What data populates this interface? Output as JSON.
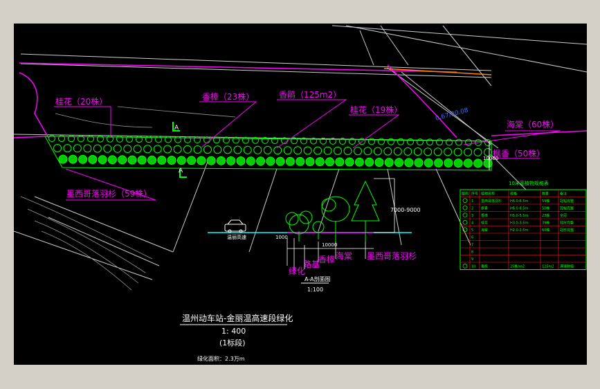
{
  "drawing": {
    "title": "温州动车站-金丽温高速段绿化",
    "scale": "1: 400",
    "section_label": "(1标段)",
    "note": "绿化面积：2.3万m",
    "colors": {
      "background": "#000000",
      "label": "#ff00ff",
      "plant": "#00ff00",
      "table": "#00ff00",
      "cyan": "#00ffff",
      "orange": "#ff8800",
      "frame": "#d4d0c8"
    }
  },
  "plan_labels": {
    "guihua_left": "桂花（20株）",
    "xiangzhang": "香樟（23株）",
    "xiangpeng": "香鹃（125m2）",
    "guihua_right": "桂花（19株）",
    "haitang": "海棠（60株）",
    "fengxiang": "枫香（50株）",
    "moxige": "墨西哥落羽杉（59株）",
    "section_mark_a1": "A",
    "section_mark_a2": "A",
    "width_dim": "10000"
  },
  "section": {
    "title": "A-A剖面图",
    "scale": "1:100",
    "height_dim": "7000-9000",
    "width_dim": "10000",
    "offset_dim": "1000",
    "road_label": "温丽高速",
    "callouts": [
      "绿化",
      "路基",
      "香樟",
      "海棠",
      "墨西哥落羽杉"
    ]
  },
  "table": {
    "title": "10米宽植物规格表",
    "headers": [
      "图例",
      "序号",
      "植物名称",
      "规格",
      "数量",
      "备注"
    ],
    "rows": [
      [
        "",
        "1",
        "墨西哥落羽杉",
        "H6.0-6.5m",
        "59株",
        "冠幅完整"
      ],
      [
        "",
        "2",
        "枫香",
        "H6.0-6.5m",
        "50株",
        "冠幅完整"
      ],
      [
        "",
        "3",
        "香樟",
        "H5.0-5.5m",
        "23株",
        "全冠"
      ],
      [
        "",
        "4",
        "桂花",
        "H3.0-3.5m",
        "39株",
        "冠形完整"
      ],
      [
        "",
        "5",
        "海棠",
        "H2.0-2.5m",
        "60株",
        "冠形完整"
      ],
      [
        "",
        "6",
        "",
        "",
        "",
        ""
      ],
      [
        "",
        "7",
        "",
        "",
        "",
        ""
      ],
      [
        "",
        "8",
        "",
        "",
        "",
        ""
      ],
      [
        "",
        "9",
        "",
        "",
        "",
        ""
      ],
      [
        "",
        "10",
        "香鹃",
        "25株/m2",
        "125m2",
        "满铺种植"
      ]
    ]
  }
}
